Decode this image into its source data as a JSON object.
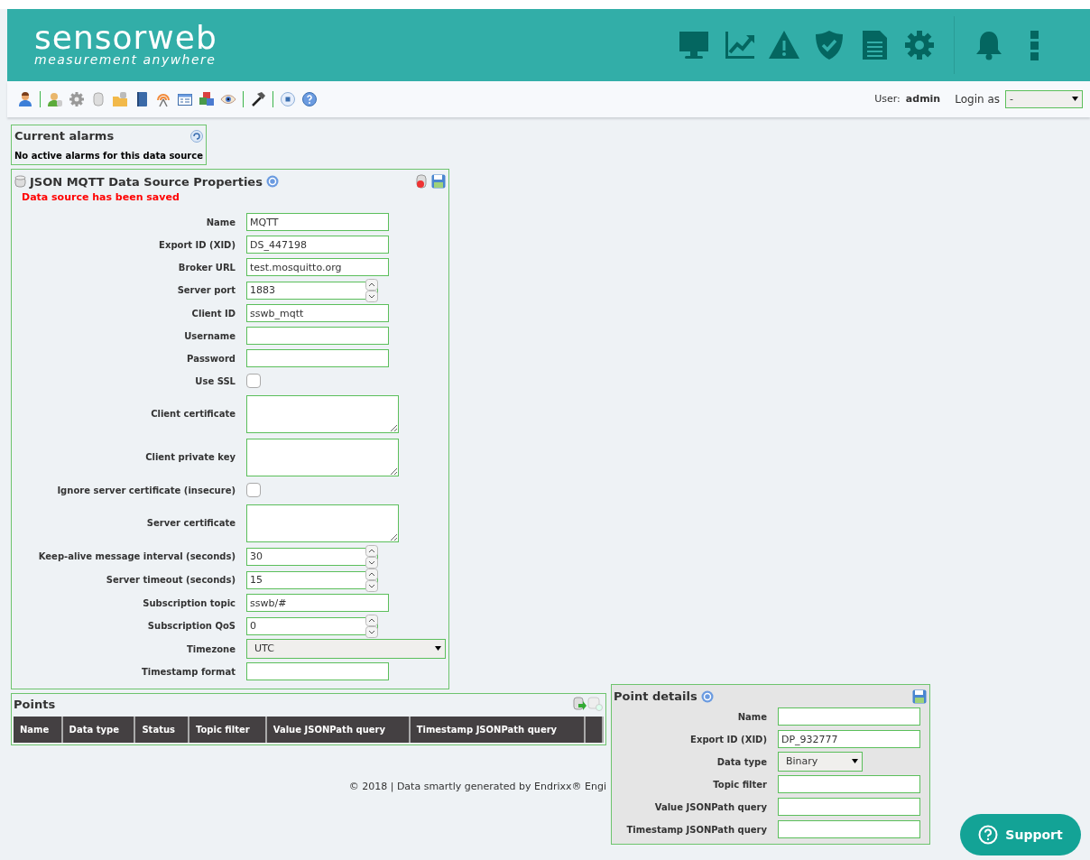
{
  "header": {
    "logo_title": "sensorweb",
    "logo_subtitle": "measurement anywhere"
  },
  "user_bar": {
    "user_label": "User:",
    "user_name": "admin",
    "login_label": "Login as",
    "login_value": "-"
  },
  "alarms": {
    "title": "Current alarms",
    "message": "No active alarms for this data source"
  },
  "data_source": {
    "title": "JSON MQTT Data Source Properties",
    "message": "Data source has been saved",
    "fields": [
      {
        "label": "Name",
        "kind": "text",
        "value": "MQTT"
      },
      {
        "label": "Export ID (XID)",
        "kind": "text",
        "value": "DS_447198"
      },
      {
        "label": "Broker URL",
        "kind": "text",
        "value": "test.mosquitto.org"
      },
      {
        "label": "Server port",
        "kind": "number",
        "value": "1883"
      },
      {
        "label": "Client ID",
        "kind": "text",
        "value": "sswb_mqtt"
      },
      {
        "label": "Username",
        "kind": "text"
      },
      {
        "label": "Password",
        "kind": "text"
      },
      {
        "label": "Use SSL",
        "kind": "checkbox",
        "checked": false
      },
      {
        "label": "Client certificate",
        "kind": "textarea"
      },
      {
        "label": "Client private key",
        "kind": "textarea"
      },
      {
        "label": "Ignore server certificate (insecure)",
        "kind": "checkbox",
        "checked": false
      },
      {
        "label": "Server certificate",
        "kind": "textarea"
      },
      {
        "label": "Keep-alive message interval (seconds)",
        "kind": "number",
        "value": "30"
      },
      {
        "label": "Server timeout (seconds)",
        "kind": "number",
        "value": "15"
      },
      {
        "label": "Subscription topic",
        "kind": "text",
        "value": "sswb/#"
      },
      {
        "label": "Subscription QoS",
        "kind": "number",
        "value": "0"
      },
      {
        "label": "Timezone",
        "kind": "select",
        "value": "UTC"
      },
      {
        "label": "Timestamp format",
        "kind": "text"
      }
    ]
  },
  "points": {
    "title": "Points",
    "columns": [
      "Name",
      "Data type",
      "Status",
      "Topic filter",
      "Value JSONPath query",
      "Timestamp JSONPath query"
    ]
  },
  "point_details": {
    "title": "Point details",
    "fields": [
      {
        "label": "Name",
        "kind": "text"
      },
      {
        "label": "Export ID (XID)",
        "kind": "text",
        "value": "DP_932777"
      },
      {
        "label": "Data type",
        "kind": "select",
        "value": "Binary"
      },
      {
        "label": "Topic filter",
        "kind": "text"
      },
      {
        "label": "Value JSONPath query",
        "kind": "text"
      },
      {
        "label": "Timestamp JSONPath query",
        "kind": "text"
      }
    ]
  },
  "footer": "© 2018 | Data smartly generated by Endrixx® Engi",
  "support_button": "Support"
}
